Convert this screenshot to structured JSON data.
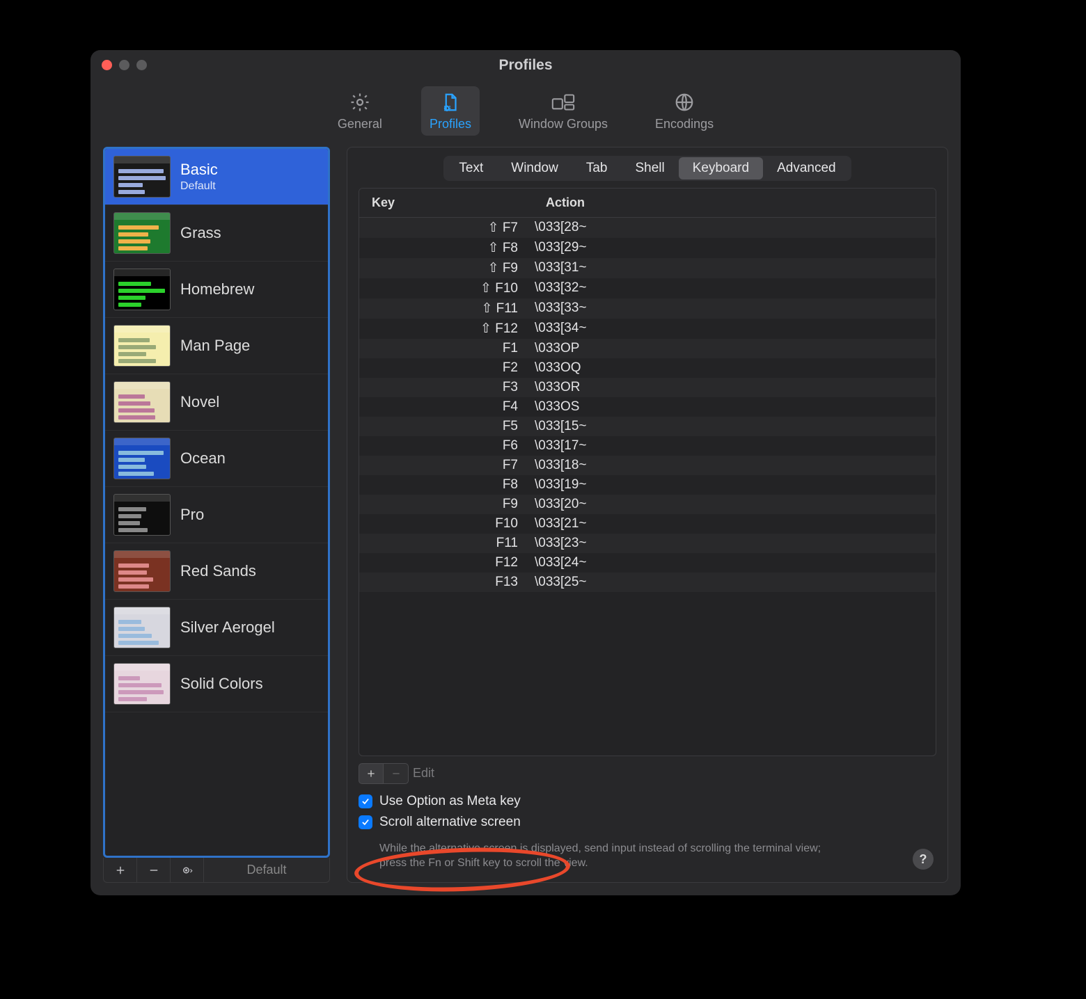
{
  "window": {
    "title": "Profiles"
  },
  "toolbar": {
    "items": [
      {
        "id": "general",
        "label": "General"
      },
      {
        "id": "profiles",
        "label": "Profiles"
      },
      {
        "id": "windowgroups",
        "label": "Window Groups"
      },
      {
        "id": "encodings",
        "label": "Encodings"
      }
    ],
    "active": "profiles"
  },
  "sidebar": {
    "profiles": [
      {
        "name": "Basic",
        "sub": "Default",
        "thumb": "basic",
        "selected": true
      },
      {
        "name": "Grass",
        "thumb": "grass"
      },
      {
        "name": "Homebrew",
        "thumb": "homebrew"
      },
      {
        "name": "Man Page",
        "thumb": "manpage"
      },
      {
        "name": "Novel",
        "thumb": "novel"
      },
      {
        "name": "Ocean",
        "thumb": "ocean"
      },
      {
        "name": "Pro",
        "thumb": "pro"
      },
      {
        "name": "Red Sands",
        "thumb": "redsands"
      },
      {
        "name": "Silver Aerogel",
        "thumb": "silver"
      },
      {
        "name": "Solid Colors",
        "thumb": "solid"
      }
    ],
    "default_button": "Default"
  },
  "tabs": {
    "items": [
      "Text",
      "Window",
      "Tab",
      "Shell",
      "Keyboard",
      "Advanced"
    ],
    "active": "Keyboard"
  },
  "keytable": {
    "headers": {
      "key": "Key",
      "action": "Action"
    },
    "rows": [
      {
        "key": "⇧ F7",
        "action": "\\033[28~"
      },
      {
        "key": "⇧ F8",
        "action": "\\033[29~"
      },
      {
        "key": "⇧ F9",
        "action": "\\033[31~"
      },
      {
        "key": "⇧ F10",
        "action": "\\033[32~"
      },
      {
        "key": "⇧ F11",
        "action": "\\033[33~"
      },
      {
        "key": "⇧ F12",
        "action": "\\033[34~"
      },
      {
        "key": "F1",
        "action": "\\033OP"
      },
      {
        "key": "F2",
        "action": "\\033OQ"
      },
      {
        "key": "F3",
        "action": "\\033OR"
      },
      {
        "key": "F4",
        "action": "\\033OS"
      },
      {
        "key": "F5",
        "action": "\\033[15~"
      },
      {
        "key": "F6",
        "action": "\\033[17~"
      },
      {
        "key": "F7",
        "action": "\\033[18~"
      },
      {
        "key": "F8",
        "action": "\\033[19~"
      },
      {
        "key": "F9",
        "action": "\\033[20~"
      },
      {
        "key": "F10",
        "action": "\\033[21~"
      },
      {
        "key": "F11",
        "action": "\\033[23~"
      },
      {
        "key": "F12",
        "action": "\\033[24~"
      },
      {
        "key": "F13",
        "action": "\\033[25~"
      }
    ],
    "edit_label": "Edit"
  },
  "checks": {
    "option_meta": {
      "checked": true,
      "label": "Use Option as Meta key"
    },
    "scroll_alt": {
      "checked": true,
      "label": "Scroll alternative screen"
    },
    "help": "While the alternative screen is displayed, send input instead of scrolling the terminal view; press the Fn or Shift key to scroll the view."
  },
  "help_button": "?"
}
